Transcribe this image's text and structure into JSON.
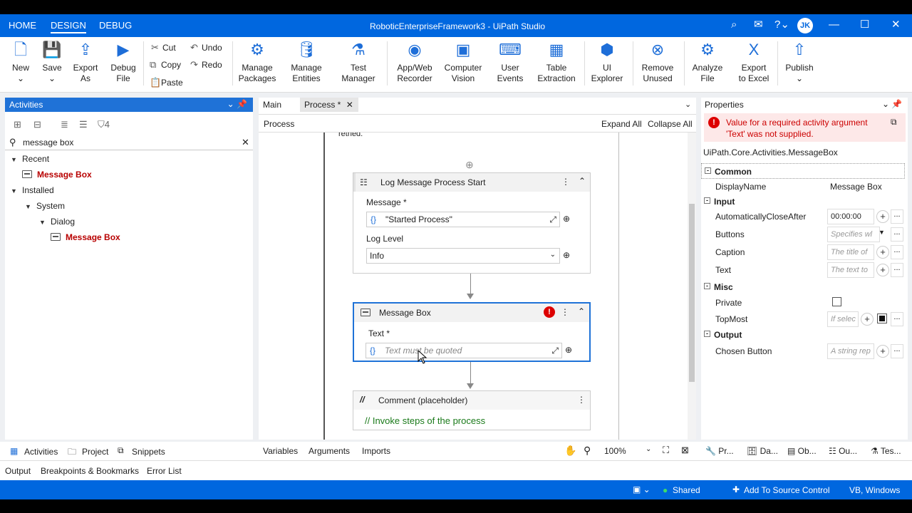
{
  "top_tabs": [
    "HOME",
    "DESIGN",
    "DEBUG"
  ],
  "window_title": "RoboticEnterpriseFramework3 - UiPath Studio",
  "user_initials": "JK",
  "ribbon": {
    "new": "New",
    "save": "Save",
    "export_as": "Export\nAs",
    "debug_file": "Debug\nFile",
    "cut": "Cut",
    "copy": "Copy",
    "paste": "Paste",
    "undo": "Undo",
    "redo": "Redo",
    "manage_packages": "Manage\nPackages",
    "manage_entities": "Manage\nEntities",
    "test_manager": "Test\nManager",
    "app_web_recorder": "App/Web\nRecorder",
    "computer_vision": "Computer\nVision",
    "user_events": "User\nEvents",
    "table_extraction": "Table\nExtraction",
    "ui_explorer": "UI\nExplorer",
    "remove_unused": "Remove\nUnused",
    "analyze_file": "Analyze\nFile",
    "export_to_excel": "Export\nto Excel",
    "publish": "Publish"
  },
  "activities": {
    "title": "Activities",
    "search_value": "message box",
    "recent": "Recent",
    "recent_item": "Message Box",
    "installed": "Installed",
    "system": "System",
    "dialog": "Dialog",
    "dialog_item": "Message Box"
  },
  "designer": {
    "tab_main": "Main",
    "tab_process": "Process *",
    "breadcrumb": "Process",
    "expand_all": "Expand All",
    "collapse_all": "Collapse All",
    "top_text": "retried.",
    "log_card": {
      "title": "Log Message Process Start",
      "message_label": "Message *",
      "message_value": "\"Started Process\"",
      "level_label": "Log Level",
      "level_value": "Info"
    },
    "msg_card": {
      "title": "Message Box",
      "text_label": "Text *",
      "text_placeholder": "Text must be quoted"
    },
    "comment_card": {
      "title": "Comment (placeholder)",
      "body": "// Invoke steps of the process"
    },
    "bottom_tabs": [
      "Variables",
      "Arguments",
      "Imports"
    ],
    "zoom": "100%"
  },
  "properties": {
    "title": "Properties",
    "error": "Value for a required activity argument 'Text' was not supplied.",
    "type_name": "UiPath.Core.Activities.MessageBox",
    "cat_common": "Common",
    "display_name_label": "DisplayName",
    "display_name_value": "Message Box",
    "cat_input": "Input",
    "auto_close_label": "AutomaticallyCloseAfter",
    "auto_close_value": "00:00:00",
    "buttons_label": "Buttons",
    "buttons_ph": "Specifies wl",
    "caption_label": "Caption",
    "caption_ph": "The title of",
    "text_label": "Text",
    "text_ph": "The text to",
    "cat_misc": "Misc",
    "private_label": "Private",
    "topmost_label": "TopMost",
    "topmost_ph": "If selec",
    "cat_output": "Output",
    "chosen_label": "Chosen Button",
    "chosen_ph": "A string rep"
  },
  "left_bottom_tabs": [
    "Activities",
    "Project",
    "Snippets"
  ],
  "right_bottom_tabs": [
    "Pr...",
    "Da...",
    "Ob...",
    "Ou...",
    "Tes..."
  ],
  "output_tabs": [
    "Output",
    "Breakpoints & Bookmarks",
    "Error List"
  ],
  "status": {
    "shared": "Shared",
    "source_control": "Add To Source Control",
    "lang": "VB, Windows"
  }
}
